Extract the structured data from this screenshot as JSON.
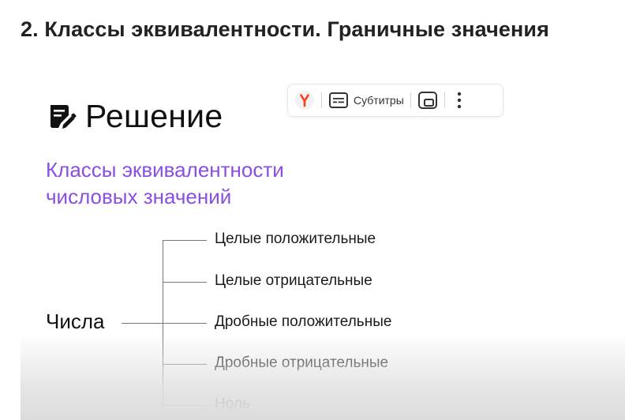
{
  "page": {
    "title": "2. Классы эквивалентности. Граничные значения"
  },
  "slide": {
    "heading": "Решение",
    "subtitle_lines": [
      "Классы эквивалентности",
      "числовых значений"
    ],
    "accent_color": "#8a4fe0",
    "tree": {
      "root": "Числа",
      "branches": [
        "Целые положительные",
        "Целые отрицательные",
        "Дробные положительные",
        "Дробные отрицательные",
        "Ноль"
      ]
    }
  },
  "player_toolbar": {
    "brand_icon": "yandex-icon",
    "subtitles_label": "Субтитры",
    "subtitles_icon": "subtitles-icon",
    "pip_icon": "picture-in-picture-icon",
    "more_icon": "more-vertical-icon",
    "brand_color": "#fc3f1d"
  }
}
